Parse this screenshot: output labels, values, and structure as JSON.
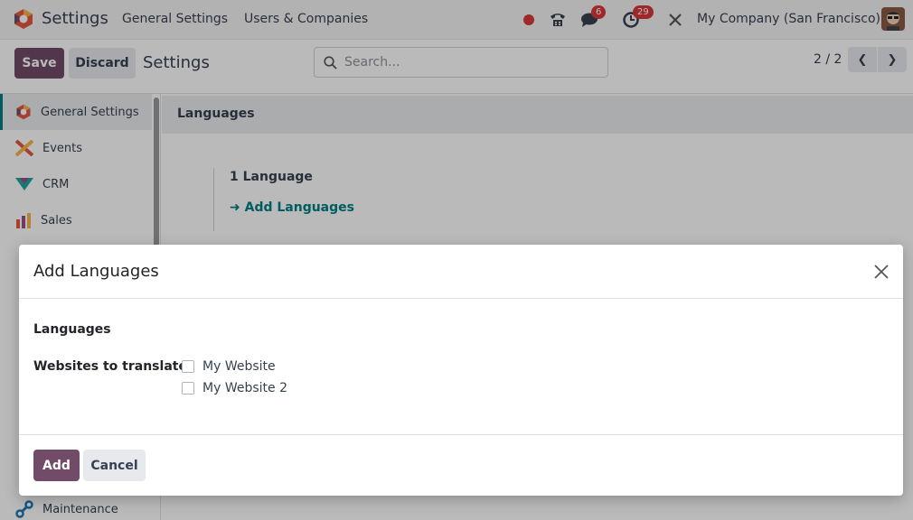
{
  "navbar": {
    "app_name": "Settings",
    "menu": [
      "General Settings",
      "Users & Companies"
    ],
    "messages_count": "6",
    "activities_count": "29",
    "company": "My Company (San Francisco)"
  },
  "control_panel": {
    "save_label": "Save",
    "discard_label": "Discard",
    "breadcrumb": "Settings",
    "search_placeholder": "Search...",
    "pager": "2 / 2"
  },
  "sidebar": {
    "items": [
      {
        "label": "General Settings",
        "icon": "settings-icon"
      },
      {
        "label": "Events",
        "icon": "events-icon"
      },
      {
        "label": "CRM",
        "icon": "crm-icon"
      },
      {
        "label": "Sales",
        "icon": "sales-icon"
      },
      {
        "label": "Maintenance",
        "icon": "maintenance-icon"
      }
    ]
  },
  "main": {
    "section_title": "Languages",
    "language_count": "1 Language",
    "add_languages_link": "Add Languages"
  },
  "dialog": {
    "title": "Add Languages",
    "languages_label": "Languages",
    "websites_label": "Websites to translate",
    "websites": [
      "My Website",
      "My Website 2"
    ],
    "add_label": "Add",
    "cancel_label": "Cancel"
  },
  "colors": {
    "primary": "#714b67",
    "link": "#017e84",
    "badge": "#d9383a"
  }
}
